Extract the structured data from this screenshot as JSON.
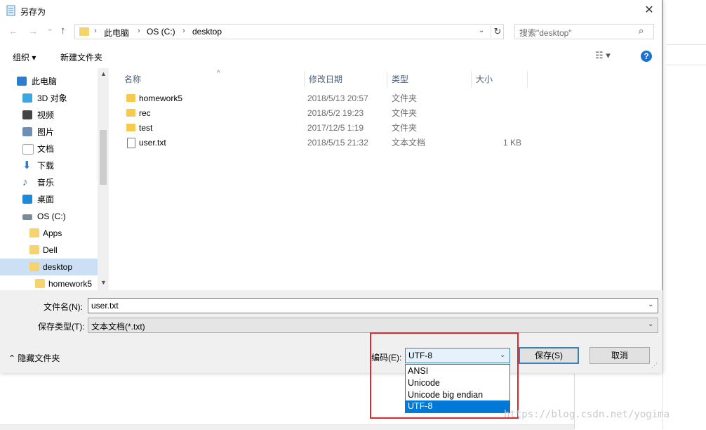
{
  "dialog": {
    "title": "另存为",
    "close_glyph": "✕"
  },
  "nav": {
    "back_glyph": "←",
    "forward_glyph": "→",
    "recent_glyph": "⌄",
    "up_glyph": "↑",
    "breadcrumbs": [
      "此电脑",
      "OS (C:)",
      "desktop"
    ],
    "separator": "›",
    "dropdown_glyph": "⌄",
    "refresh_glyph": "↻",
    "search_placeholder": "搜索\"desktop\"",
    "search_glyph": "⌕"
  },
  "toolbar": {
    "organize_label": "组织 ▾",
    "new_folder_label": "新建文件夹",
    "views_glyph": "☷ ▾",
    "help_glyph": "?"
  },
  "sidebar": {
    "items": [
      {
        "label": "此电脑",
        "icon": "computer-icon",
        "color": "#2b7cd3"
      },
      {
        "label": "3D 对象",
        "icon": "cube-icon",
        "color": "#3aa7e0"
      },
      {
        "label": "视频",
        "icon": "video-icon",
        "color": "#444444"
      },
      {
        "label": "图片",
        "icon": "picture-icon",
        "color": "#6b8fb5"
      },
      {
        "label": "文档",
        "icon": "document-icon",
        "color": "#9aa6b3"
      },
      {
        "label": "下载",
        "icon": "download-icon",
        "color": "#2b7cd3"
      },
      {
        "label": "音乐",
        "icon": "music-icon",
        "color": "#2b7cd3"
      },
      {
        "label": "桌面",
        "icon": "desktop-icon",
        "color": "#1e88d9"
      },
      {
        "label": "OS (C:)",
        "icon": "drive-icon",
        "color": "#7d8b99"
      },
      {
        "label": "Apps",
        "icon": "folder-icon",
        "color": "#f6d36c"
      },
      {
        "label": "Dell",
        "icon": "folder-icon",
        "color": "#f6d36c"
      },
      {
        "label": "desktop",
        "icon": "folder-icon",
        "color": "#f6d36c",
        "selected": true
      },
      {
        "label": "homework5",
        "icon": "folder-icon",
        "color": "#f6d36c"
      }
    ],
    "scroll_up": "▲",
    "scroll_down": "▼"
  },
  "files": {
    "sort_glyph": "^",
    "columns": [
      "名称",
      "修改日期",
      "类型",
      "大小"
    ],
    "rows": [
      {
        "name": "homework5",
        "date": "2018/5/13 20:57",
        "type": "文件夹",
        "size": "",
        "kind": "folder"
      },
      {
        "name": "rec",
        "date": "2018/5/2 19:23",
        "type": "文件夹",
        "size": "",
        "kind": "folder"
      },
      {
        "name": "test",
        "date": "2017/12/5 1:19",
        "type": "文件夹",
        "size": "",
        "kind": "folder"
      },
      {
        "name": "user.txt",
        "date": "2018/5/15 21:32",
        "type": "文本文档",
        "size": "1 KB",
        "kind": "text"
      }
    ]
  },
  "form": {
    "filename_label": "文件名(N):",
    "filename_value": "user.txt",
    "filetype_label": "保存类型(T):",
    "filetype_value": "文本文档(*.txt)",
    "chevron": "⌄",
    "hide_folders_label": "⌃ 隐藏文件夹",
    "encoding_label": "编码(E):",
    "encoding_value": "UTF-8",
    "save_label": "保存(S)",
    "cancel_label": "取消",
    "resize_grip": "⋰"
  },
  "encoding_options": [
    "ANSI",
    "Unicode",
    "Unicode big endian",
    "UTF-8"
  ],
  "encoding_selected": "UTF-8",
  "watermark": "https://blog.csdn.net/yogima",
  "colors": {
    "highlight_box": "#e0262e",
    "selection_blue": "#0078d7",
    "nav_selected": "#cce0f5",
    "folder_yellow": "#f6c94f"
  }
}
